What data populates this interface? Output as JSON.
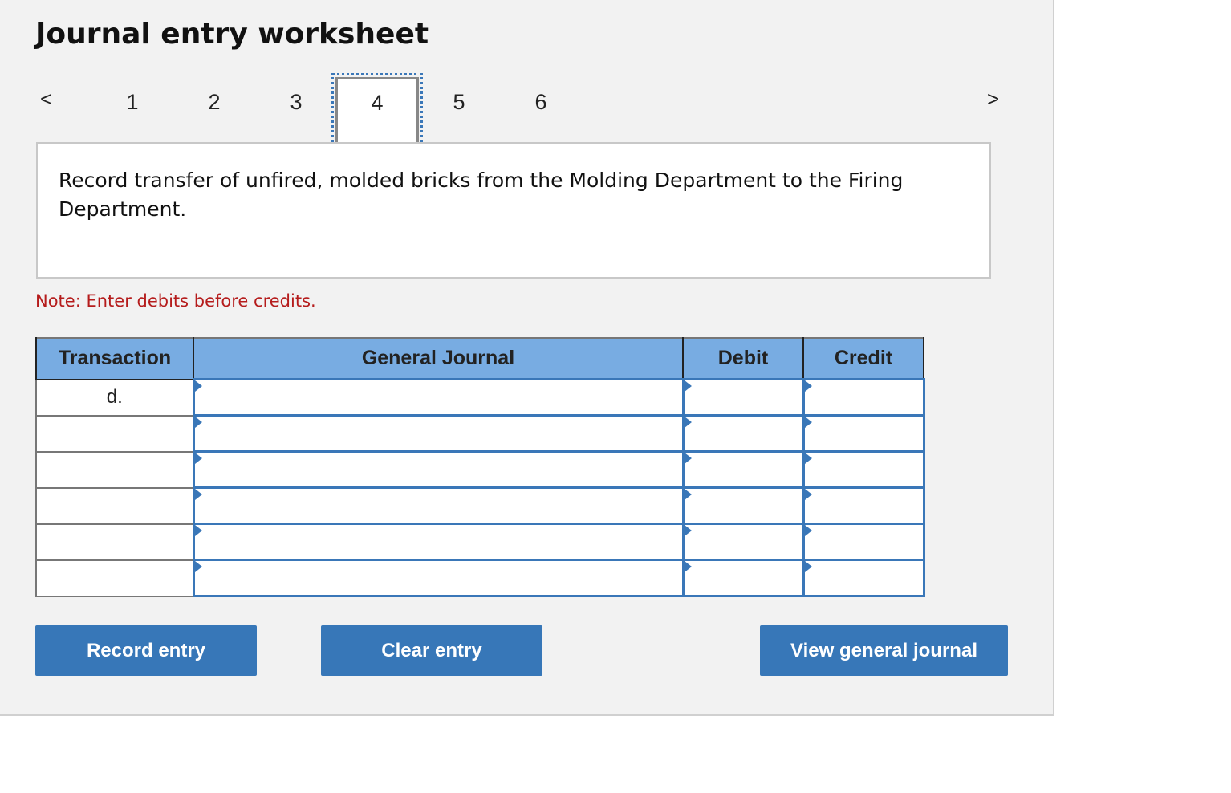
{
  "title": "Journal entry worksheet",
  "nav": {
    "prev": "<",
    "next": ">",
    "tabs": [
      "1",
      "2",
      "3",
      "4",
      "5",
      "6"
    ],
    "active_tab": "4"
  },
  "prompt": "Record transfer of unfired, molded bricks from the Molding Department to the Firing Department.",
  "note": "Note: Enter debits before credits.",
  "table": {
    "headers": [
      "Transaction",
      "General Journal",
      "Debit",
      "Credit"
    ],
    "rows": [
      {
        "transaction": "d.",
        "account": "",
        "debit": "",
        "credit": ""
      },
      {
        "transaction": "",
        "account": "",
        "debit": "",
        "credit": ""
      },
      {
        "transaction": "",
        "account": "",
        "debit": "",
        "credit": ""
      },
      {
        "transaction": "",
        "account": "",
        "debit": "",
        "credit": ""
      },
      {
        "transaction": "",
        "account": "",
        "debit": "",
        "credit": ""
      },
      {
        "transaction": "",
        "account": "",
        "debit": "",
        "credit": ""
      }
    ]
  },
  "buttons": {
    "record": "Record entry",
    "clear": "Clear entry",
    "view": "View general journal"
  },
  "colors": {
    "accent": "#3777b8",
    "header": "#78ace2",
    "note": "#b51c1c"
  }
}
